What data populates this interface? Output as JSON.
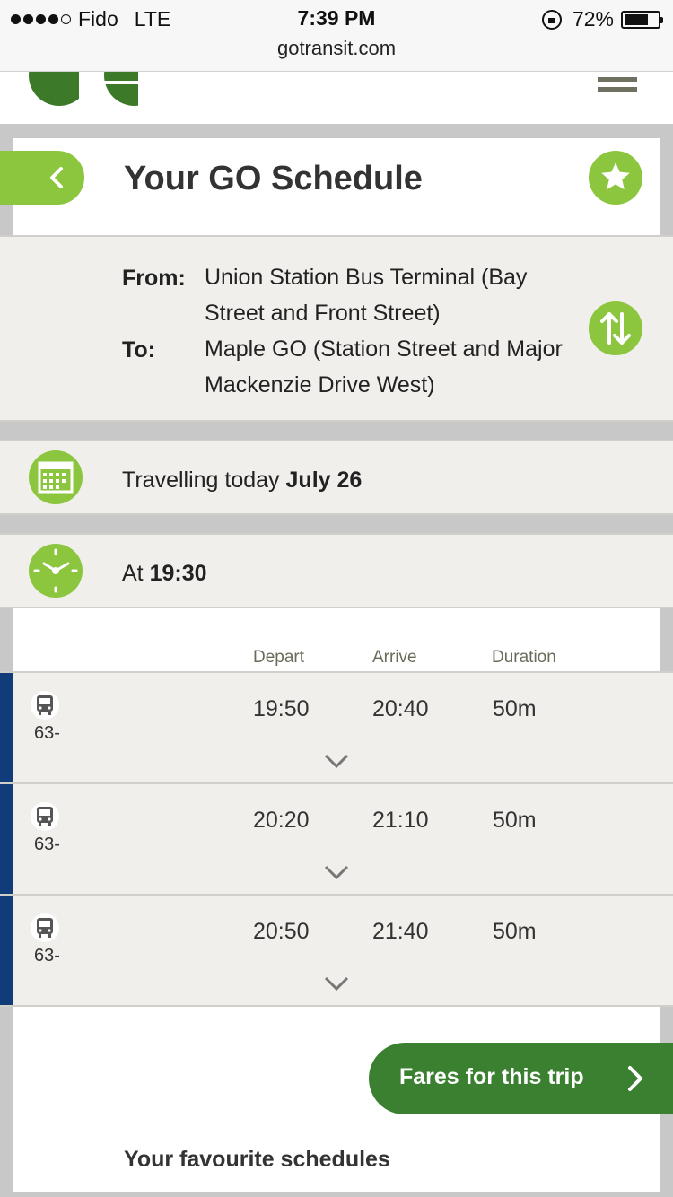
{
  "status_bar": {
    "carrier": "Fido",
    "network": "LTE",
    "time": "7:39 PM",
    "battery": "72%",
    "battery_level": 0.72
  },
  "browser": {
    "url": "gotransit.com"
  },
  "header": {
    "logo_icon": "go-transit-logo",
    "menu_icon": "hamburger-menu-icon"
  },
  "page": {
    "title": "Your GO Schedule",
    "back_icon": "chevron-left-icon",
    "favorite_icon": "star-icon"
  },
  "route": {
    "from_label": "From:",
    "from_line1": "Union Station Bus Terminal (Bay",
    "from_line2": "Street and Front Street)",
    "to_label": "To:",
    "to_line1": "Maple GO (Station Street and Major",
    "to_line2": "Mackenzie Drive West)",
    "swap_icon": "swap-vertical-icon"
  },
  "date": {
    "prefix": "Travelling today",
    "value": "July 26",
    "icon": "calendar-icon"
  },
  "time": {
    "prefix": "At",
    "value": "19:30",
    "icon": "clock-icon"
  },
  "columns": {
    "depart": "Depart",
    "arrive": "Arrive",
    "duration": "Duration"
  },
  "trips": [
    {
      "route": "63-",
      "depart": "19:50",
      "arrive": "20:40",
      "duration": "50m"
    },
    {
      "route": "63-",
      "depart": "20:20",
      "arrive": "21:10",
      "duration": "50m"
    },
    {
      "route": "63-",
      "depart": "20:50",
      "arrive": "21:40",
      "duration": "50m"
    }
  ],
  "colors": {
    "accent": "#8cc63f",
    "brand_green": "#3a8030",
    "route_stripe": "#103d7a"
  },
  "fares_button": "Fares for this trip",
  "favourites_title": "Your favourite schedules"
}
